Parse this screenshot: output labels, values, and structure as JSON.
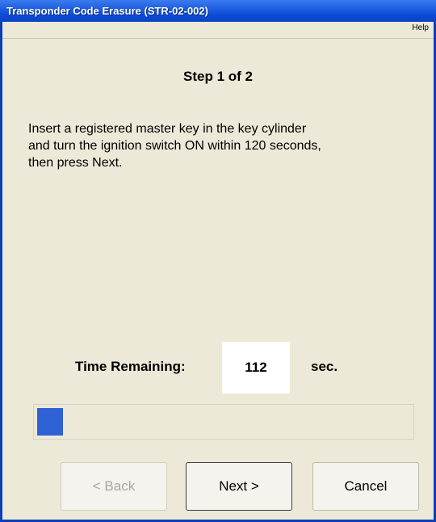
{
  "window": {
    "title": "Transponder Code Erasure (STR-02-002)"
  },
  "menu": {
    "help_label": "Help"
  },
  "step": {
    "label": "Step 1 of 2"
  },
  "instructions": {
    "line1": "Insert a registered master key in the key cylinder",
    "line2": "and turn the ignition switch ON within 120 seconds,",
    "line3": "then press Next."
  },
  "timer": {
    "label": "Time Remaining:",
    "value": "112",
    "unit": "sec."
  },
  "progress": {
    "fraction": 0.07,
    "color": "#2e62d4"
  },
  "buttons": {
    "back_label": "< Back",
    "next_label": "Next >",
    "cancel_label": "Cancel"
  },
  "colors": {
    "titlebar": "#0a44c4",
    "window_bg": "#ece9d8"
  }
}
